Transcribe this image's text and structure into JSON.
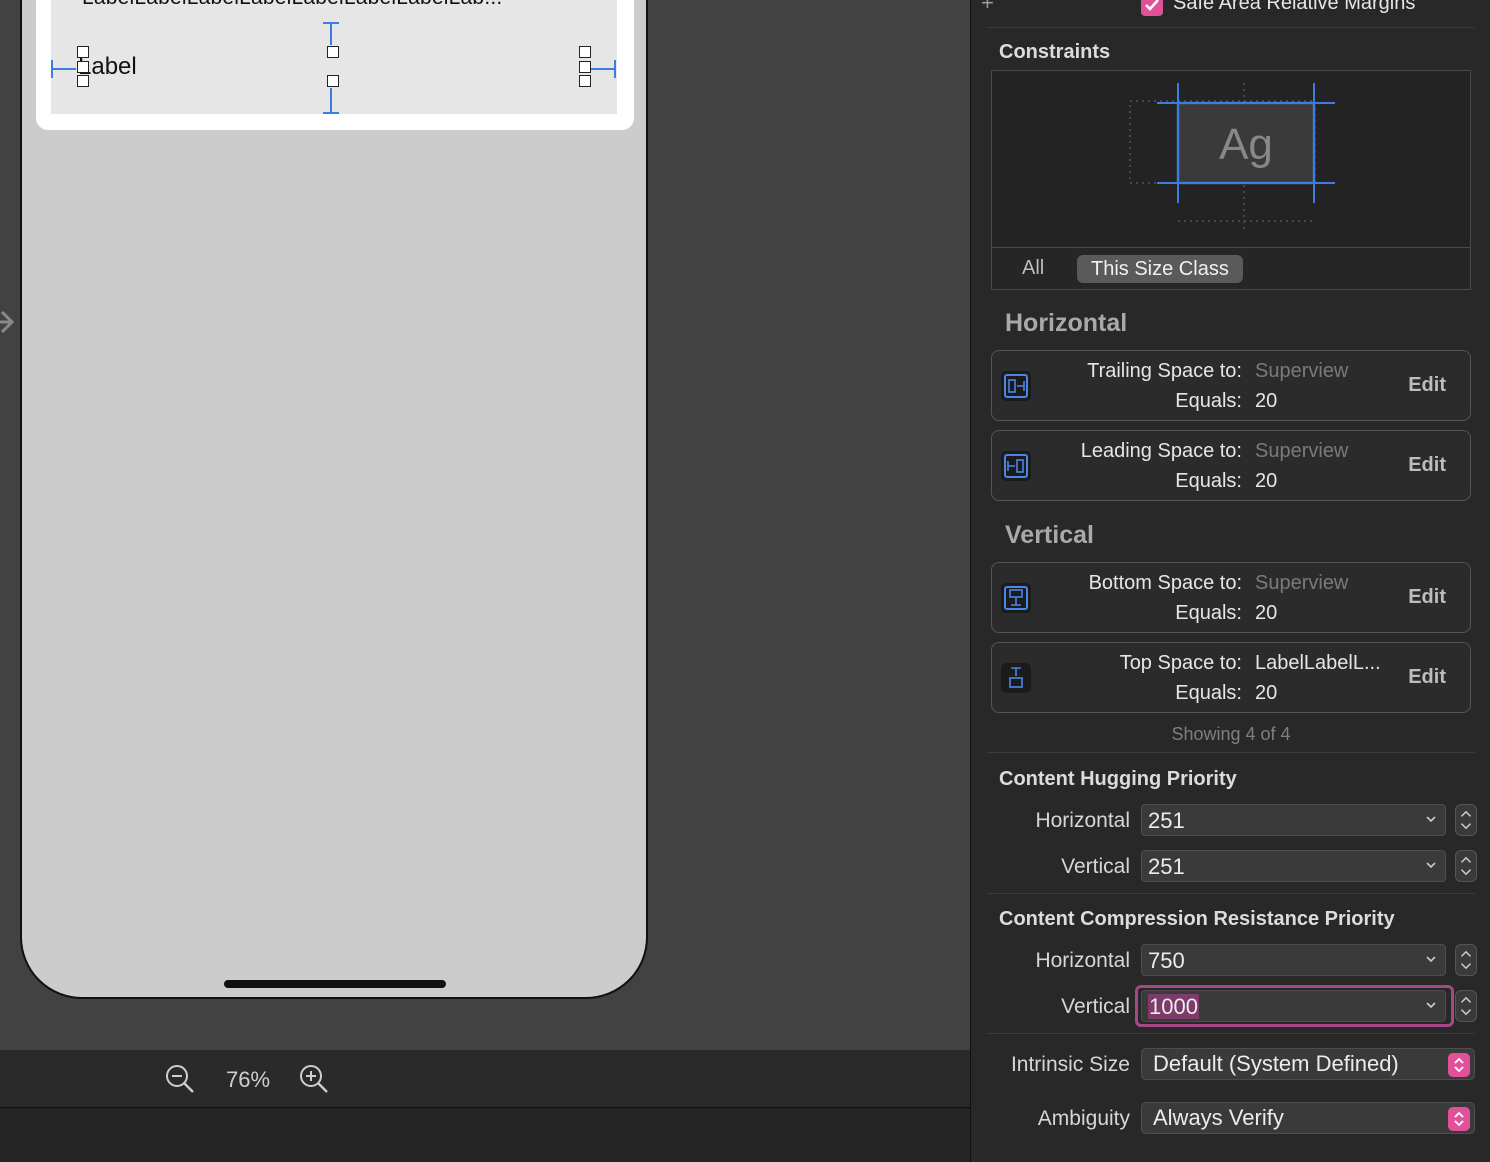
{
  "canvas": {
    "long_label_text": "LabelLabelLabelLabelLabelLabelLabelLab...",
    "selected_label_text": "Label"
  },
  "zoom_bar": {
    "zoom_level": "76%",
    "zoom_out_icon": "zoom-out-icon",
    "zoom_in_icon": "zoom-in-icon"
  },
  "inspector": {
    "safe_area_label": "Safe Area Relative Margins",
    "safe_area_checked": true,
    "constraints_title": "Constraints",
    "diagram_text": "Ag",
    "filters": {
      "all": "All",
      "size_class": "This Size Class",
      "selected": "This Size Class"
    },
    "horizontal_title": "Horizontal",
    "vertical_title": "Vertical",
    "edit_label": "Edit",
    "horizontal_constraints": [
      {
        "key": "Trailing Space to:",
        "target": "Superview",
        "equals_key": "Equals:",
        "equals": "20",
        "icon": "trailing-space-icon"
      },
      {
        "key": "Leading Space to:",
        "target": "Superview",
        "equals_key": "Equals:",
        "equals": "20",
        "icon": "leading-space-icon"
      }
    ],
    "vertical_constraints": [
      {
        "key": "Bottom Space to:",
        "target": "Superview",
        "equals_key": "Equals:",
        "equals": "20",
        "icon": "bottom-space-icon"
      },
      {
        "key": "Top Space to:",
        "target": "LabelLabelL...",
        "equals_key": "Equals:",
        "equals": "20",
        "icon": "top-space-icon"
      }
    ],
    "showing": "Showing 4 of 4",
    "hugging": {
      "title": "Content Hugging Priority",
      "horizontal_label": "Horizontal",
      "horizontal_value": "251",
      "vertical_label": "Vertical",
      "vertical_value": "251"
    },
    "compression": {
      "title": "Content Compression Resistance Priority",
      "horizontal_label": "Horizontal",
      "horizontal_value": "750",
      "vertical_label": "Vertical",
      "vertical_value": "1000"
    },
    "intrinsic_size": {
      "label": "Intrinsic Size",
      "value": "Default (System Defined)"
    },
    "ambiguity": {
      "label": "Ambiguity",
      "value": "Always Verify"
    }
  },
  "colors": {
    "accent": "#e0519a",
    "constraint_blue": "#3c7ee0",
    "focus_ring": "#a6478a",
    "canvas_bg": "#424242",
    "inspector_bg": "#282828"
  }
}
